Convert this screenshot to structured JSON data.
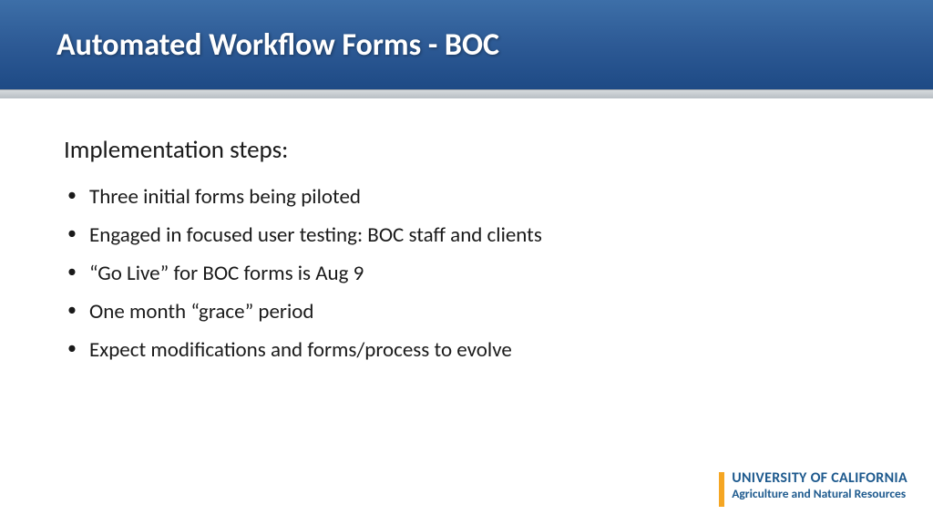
{
  "header": {
    "title": "Automated Workflow Forms - BOC"
  },
  "content": {
    "heading": "Implementation steps:",
    "bullets": [
      "Three initial forms being piloted",
      "Engaged in focused user testing: BOC staff and clients",
      "“Go Live” for BOC forms is Aug 9",
      "One month “grace” period",
      "Expect modifications and forms/process to evolve"
    ]
  },
  "footer": {
    "logo_line1": "UNIVERSITY OF CALIFORNIA",
    "logo_line2": "Agriculture and Natural Resources"
  }
}
